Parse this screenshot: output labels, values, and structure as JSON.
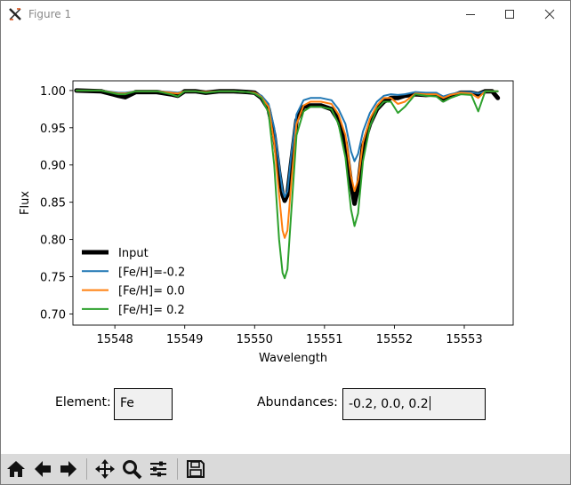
{
  "window": {
    "title": "Figure 1",
    "icon": "matplotlib-x-icon"
  },
  "chart_data": {
    "type": "line",
    "xlabel": "Wavelength",
    "ylabel": "Flux",
    "xlim": [
      15547.4,
      15553.7
    ],
    "ylim": [
      0.685,
      1.013
    ],
    "xticks": [
      15548,
      15549,
      15550,
      15551,
      15552,
      15553
    ],
    "yticks": [
      0.7,
      0.75,
      0.8,
      0.85,
      0.9,
      0.95,
      1.0
    ],
    "ytick_labels": [
      "0.70",
      "0.75",
      "0.80",
      "0.85",
      "0.90",
      "0.95",
      "1.00"
    ],
    "grid": false,
    "legend_position": "lower-left",
    "series": [
      {
        "name": "Input",
        "color": "#000000",
        "width": 5,
        "x": [
          15547.45,
          15547.8,
          15548.05,
          15548.15,
          15548.3,
          15548.6,
          15548.8,
          15548.9,
          15549.0,
          15549.15,
          15549.3,
          15549.5,
          15549.7,
          15549.9,
          15550.0,
          15550.1,
          15550.2,
          15550.28,
          15550.35,
          15550.4,
          15550.43,
          15550.47,
          15550.52,
          15550.6,
          15550.7,
          15550.8,
          15550.95,
          15551.1,
          15551.2,
          15551.3,
          15551.38,
          15551.43,
          15551.48,
          15551.55,
          15551.65,
          15551.75,
          15551.85,
          15551.95,
          15552.05,
          15552.15,
          15552.3,
          15552.45,
          15552.6,
          15552.7,
          15552.8,
          15552.95,
          15553.1,
          15553.2,
          15553.3,
          15553.4,
          15553.48
        ],
        "y": [
          1.0,
          0.999,
          0.993,
          0.991,
          0.998,
          0.998,
          0.995,
          0.993,
          0.999,
          0.999,
          0.997,
          0.999,
          0.999,
          0.998,
          0.997,
          0.99,
          0.975,
          0.94,
          0.89,
          0.86,
          0.852,
          0.86,
          0.9,
          0.96,
          0.978,
          0.98,
          0.98,
          0.975,
          0.96,
          0.93,
          0.875,
          0.848,
          0.87,
          0.925,
          0.955,
          0.975,
          0.985,
          0.99,
          0.99,
          0.993,
          0.995,
          0.994,
          0.995,
          0.987,
          0.992,
          0.997,
          0.997,
          0.995,
          0.999,
          0.999,
          0.99
        ]
      },
      {
        "name": "[Fe/H]=-0.2",
        "color": "#1f77b4",
        "width": 2,
        "x": [
          15547.45,
          15547.8,
          15548.05,
          15548.15,
          15548.3,
          15548.6,
          15548.8,
          15548.9,
          15549.0,
          15549.15,
          15549.3,
          15549.5,
          15549.7,
          15549.9,
          15550.0,
          15550.1,
          15550.2,
          15550.28,
          15550.35,
          15550.4,
          15550.43,
          15550.47,
          15550.52,
          15550.6,
          15550.7,
          15550.8,
          15550.95,
          15551.1,
          15551.2,
          15551.3,
          15551.38,
          15551.43,
          15551.48,
          15551.55,
          15551.65,
          15551.75,
          15551.85,
          15551.95,
          15552.05,
          15552.15,
          15552.3,
          15552.45,
          15552.6,
          15552.7,
          15552.8,
          15552.95,
          15553.1,
          15553.2,
          15553.3,
          15553.4,
          15553.48
        ],
        "y": [
          1.0,
          1.0,
          0.997,
          0.997,
          0.999,
          0.999,
          0.998,
          0.997,
          0.999,
          0.999,
          0.998,
          0.999,
          0.999,
          0.998,
          0.997,
          0.993,
          0.982,
          0.95,
          0.9,
          0.865,
          0.857,
          0.865,
          0.91,
          0.968,
          0.987,
          0.99,
          0.99,
          0.987,
          0.975,
          0.955,
          0.918,
          0.905,
          0.915,
          0.945,
          0.97,
          0.985,
          0.993,
          0.995,
          0.994,
          0.995,
          0.998,
          0.997,
          0.997,
          0.992,
          0.995,
          0.998,
          0.998,
          0.996,
          0.999,
          0.999,
          0.999
        ]
      },
      {
        "name": "[Fe/H]= 0.0",
        "color": "#ff7f0e",
        "width": 2,
        "x": [
          15547.45,
          15547.8,
          15548.05,
          15548.15,
          15548.3,
          15548.6,
          15548.8,
          15548.9,
          15549.0,
          15549.15,
          15549.3,
          15549.5,
          15549.7,
          15549.9,
          15550.0,
          15550.1,
          15550.2,
          15550.28,
          15550.35,
          15550.4,
          15550.43,
          15550.47,
          15550.52,
          15550.6,
          15550.7,
          15550.8,
          15550.95,
          15551.1,
          15551.2,
          15551.3,
          15551.38,
          15551.43,
          15551.48,
          15551.55,
          15551.65,
          15551.75,
          15551.85,
          15551.95,
          15552.05,
          15552.15,
          15552.3,
          15552.45,
          15552.6,
          15552.7,
          15552.8,
          15552.95,
          15553.1,
          15553.2,
          15553.3,
          15553.4,
          15553.48
        ],
        "y": [
          1.0,
          1.0,
          0.996,
          0.996,
          0.999,
          0.999,
          0.997,
          0.996,
          0.999,
          0.999,
          0.998,
          0.999,
          0.999,
          0.998,
          0.997,
          0.991,
          0.978,
          0.93,
          0.86,
          0.812,
          0.802,
          0.812,
          0.87,
          0.955,
          0.98,
          0.985,
          0.985,
          0.982,
          0.968,
          0.94,
          0.885,
          0.865,
          0.88,
          0.93,
          0.962,
          0.98,
          0.99,
          0.99,
          0.982,
          0.985,
          0.996,
          0.995,
          0.995,
          0.99,
          0.994,
          0.997,
          0.996,
          0.99,
          0.999,
          0.999,
          0.999
        ]
      },
      {
        "name": "[Fe/H]= 0.2",
        "color": "#2ca02c",
        "width": 2,
        "x": [
          15547.45,
          15547.8,
          15548.05,
          15548.15,
          15548.3,
          15548.6,
          15548.8,
          15548.9,
          15549.0,
          15549.15,
          15549.3,
          15549.5,
          15549.7,
          15549.9,
          15550.0,
          15550.1,
          15550.2,
          15550.28,
          15550.35,
          15550.4,
          15550.43,
          15550.47,
          15550.52,
          15550.6,
          15550.7,
          15550.8,
          15550.95,
          15551.1,
          15551.2,
          15551.3,
          15551.38,
          15551.43,
          15551.48,
          15551.55,
          15551.65,
          15551.75,
          15551.85,
          15551.95,
          15552.05,
          15552.15,
          15552.3,
          15552.45,
          15552.6,
          15552.7,
          15552.8,
          15552.95,
          15553.1,
          15553.2,
          15553.3,
          15553.4,
          15553.48
        ],
        "y": [
          1.0,
          1.0,
          0.995,
          0.995,
          0.999,
          0.999,
          0.995,
          0.992,
          0.999,
          0.999,
          0.997,
          0.999,
          0.999,
          0.998,
          0.996,
          0.99,
          0.97,
          0.9,
          0.8,
          0.755,
          0.748,
          0.76,
          0.83,
          0.94,
          0.972,
          0.978,
          0.978,
          0.975,
          0.955,
          0.91,
          0.84,
          0.818,
          0.835,
          0.905,
          0.952,
          0.975,
          0.985,
          0.985,
          0.97,
          0.978,
          0.995,
          0.993,
          0.992,
          0.985,
          0.99,
          0.995,
          0.994,
          0.972,
          0.999,
          0.999,
          0.999
        ]
      }
    ]
  },
  "widgets": {
    "element_label": "Element:",
    "element_value": "Fe",
    "abundances_label": "Abundances:",
    "abundances_value": "-0.2, 0.0, 0.2"
  },
  "toolbar": {
    "buttons": [
      "home-icon",
      "back-arrow-icon",
      "forward-arrow-icon",
      "pan-move-icon",
      "zoom-magnifier-icon",
      "configure-subplots-icon",
      "save-floppy-icon"
    ]
  }
}
